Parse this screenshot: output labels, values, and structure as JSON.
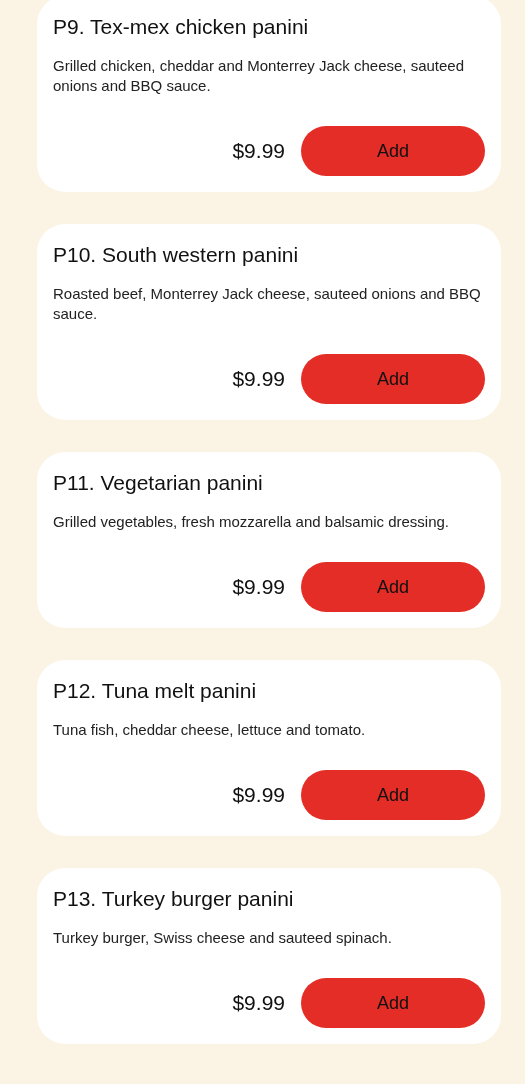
{
  "items": [
    {
      "title": "P9. Tex-mex chicken panini",
      "description": "Grilled chicken, cheddar and Monterrey Jack cheese, sauteed onions and BBQ sauce.",
      "price": "$9.99",
      "button": "Add"
    },
    {
      "title": "P10. South western panini",
      "description": "Roasted beef, Monterrey Jack cheese, sauteed onions and BBQ sauce.",
      "price": "$9.99",
      "button": "Add"
    },
    {
      "title": "P11. Vegetarian panini",
      "description": "Grilled vegetables, fresh mozzarella and balsamic dressing.",
      "price": "$9.99",
      "button": "Add"
    },
    {
      "title": "P12. Tuna melt panini",
      "description": "Tuna fish, cheddar cheese, lettuce and tomato.",
      "price": "$9.99",
      "button": "Add"
    },
    {
      "title": "P13. Turkey burger panini",
      "description": "Turkey burger, Swiss cheese and sauteed spinach.",
      "price": "$9.99",
      "button": "Add"
    }
  ]
}
